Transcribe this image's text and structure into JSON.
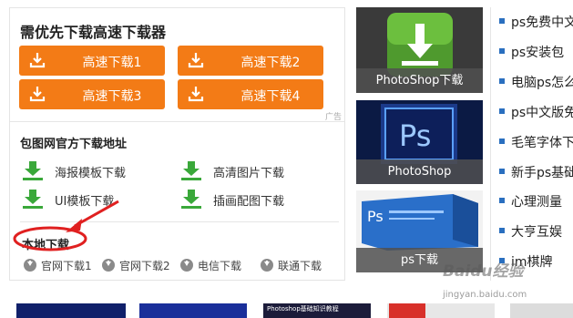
{
  "panel": {
    "title": "需优先下载高速下载器",
    "buttons": [
      "高速下载1",
      "高速下载2",
      "高速下载3",
      "高速下载4"
    ],
    "ad_label": "广告",
    "official_title": "包图网官方下载地址",
    "official_links": [
      "海报模板下载",
      "高清图片下载",
      "UI模板下载",
      "插画配图下载"
    ],
    "local_title": "本地下载",
    "mirror_links": [
      "官网下载1",
      "官网下载2",
      "电信下载",
      "联通下载"
    ]
  },
  "tiles": [
    {
      "caption": "PhotoShop下载",
      "icon": "download-icon"
    },
    {
      "caption": "PhotoShop",
      "icon": "ps-logo-icon"
    },
    {
      "caption": "ps下载",
      "icon": "ps-box-icon"
    }
  ],
  "links": [
    "ps免费中文",
    "ps安装包",
    "电脑ps怎么",
    "ps中文版免",
    "毛笔字体下",
    "新手ps基础",
    "心理测量",
    "大亨互娱",
    "im棋牌"
  ],
  "watermark": {
    "logo": "Baidu经验",
    "url": "jingyan.baidu.com"
  },
  "bottom_strip": {
    "text": "Photoshop基础知识教程"
  },
  "colors": {
    "accent": "#f37b16",
    "green": "#3aa83a",
    "annotation": "#e02020",
    "bullet": "#2a6fbf"
  }
}
